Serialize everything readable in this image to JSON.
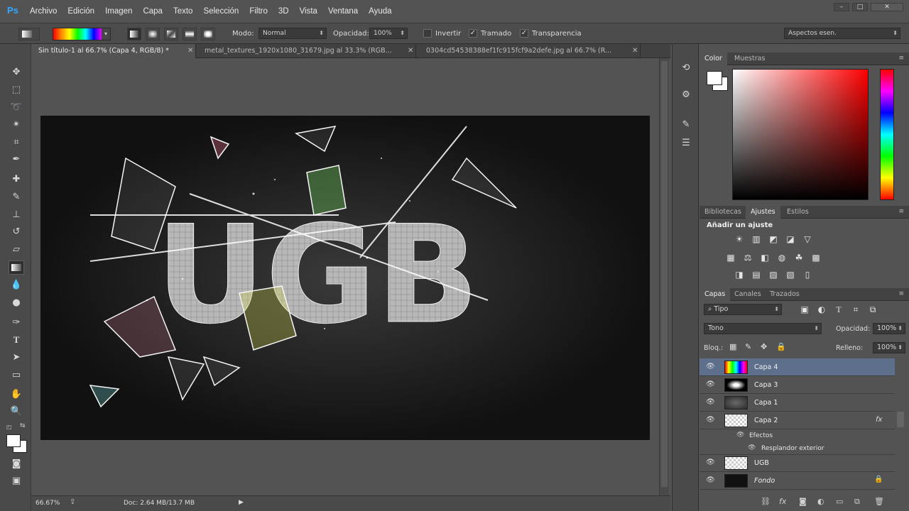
{
  "app": {
    "logo": "Ps"
  },
  "menu": [
    "Archivo",
    "Edición",
    "Imagen",
    "Capa",
    "Texto",
    "Selección",
    "Filtro",
    "3D",
    "Vista",
    "Ventana",
    "Ayuda"
  ],
  "window_controls": [
    "–",
    "□",
    "✕"
  ],
  "options": {
    "modo_label": "Modo:",
    "modo_value": "Normal",
    "opacidad_label": "Opacidad:",
    "opacidad_value": "100%",
    "invertir": "Invertir",
    "tramado": "Tramado",
    "transparencia": "Transparencia",
    "workspace": "Aspectos esen.",
    "invertir_checked": false,
    "tramado_checked": true,
    "transparencia_checked": true
  },
  "tabs": [
    {
      "label": "Sin título-1 al 66.7% (Capa 4, RGB/8) *",
      "active": true
    },
    {
      "label": "metal_textures_1920x1080_31679.jpg al 33.3% (RGB...",
      "active": false
    },
    {
      "label": "0304cd54538388ef1fc915fcf9a2defe.jpg al 66.7% (R...",
      "active": false
    }
  ],
  "artwork": {
    "text": "UGB"
  },
  "status": {
    "zoom": "66.67%",
    "doc": "Doc: 2.64 MB/13.7 MB"
  },
  "color_panel": {
    "tabs": [
      "Color",
      "Muestras"
    ],
    "active": "Color"
  },
  "adjust_panel": {
    "tabs": [
      "Bibliotecas",
      "Ajustes",
      "Estilos"
    ],
    "active": "Ajustes",
    "title": "Añadir un ajuste"
  },
  "layers_panel": {
    "tabs": [
      "Capas",
      "Canales",
      "Trazados"
    ],
    "active": "Capas",
    "filter": "Tipo",
    "blend_mode": "Tono",
    "opacity_label": "Opacidad:",
    "opacity_value": "100%",
    "lock_label": "Bloq.:",
    "fill_label": "Relleno:",
    "fill_value": "100%",
    "layers": [
      {
        "name": "Capa 4",
        "selected": true
      },
      {
        "name": "Capa 3",
        "selected": false
      },
      {
        "name": "Capa 1",
        "selected": false
      },
      {
        "name": "Capa 2",
        "selected": false,
        "fx": "fx"
      },
      {
        "name": "UGB",
        "selected": false
      },
      {
        "name": "Fondo",
        "selected": false,
        "locked": true
      }
    ],
    "effects_label": "Efectos",
    "effect_item": "Resplandor exterior"
  },
  "colors": {
    "accent": "#31a8ff",
    "selected_layer": "#5e6f8c",
    "panel_bg": "#535353"
  }
}
